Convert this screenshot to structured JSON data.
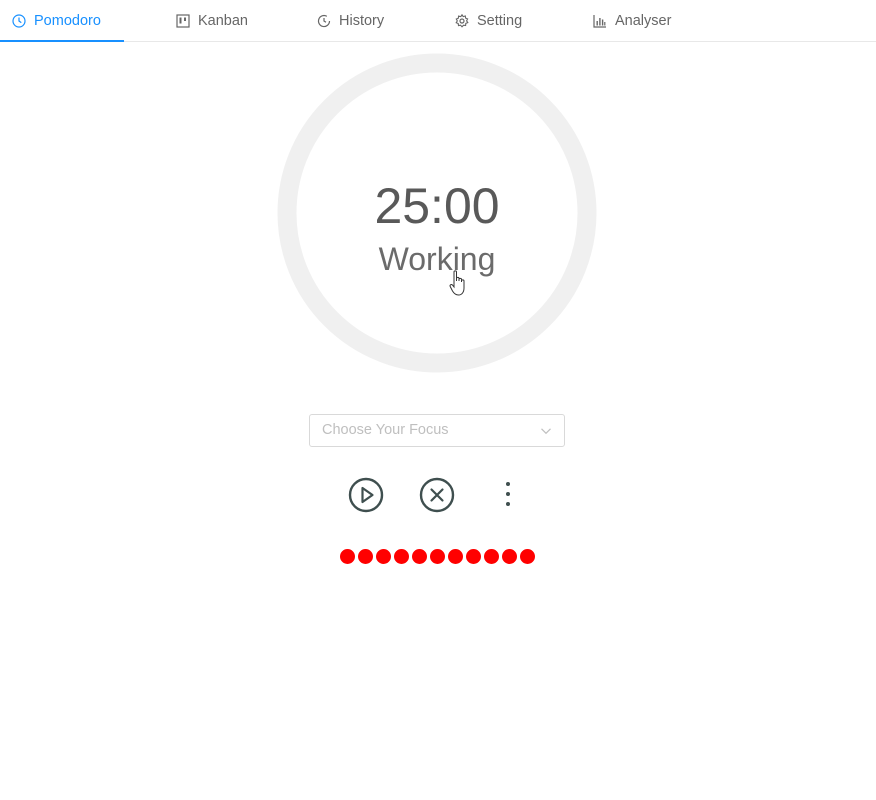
{
  "tabs": [
    {
      "label": "Pomodoro",
      "icon": "clock-icon",
      "active": true
    },
    {
      "label": "Kanban",
      "icon": "kanban-icon",
      "active": false
    },
    {
      "label": "History",
      "icon": "history-icon",
      "active": false
    },
    {
      "label": "Setting",
      "icon": "gear-icon",
      "active": false
    },
    {
      "label": "Analyser",
      "icon": "bar-chart-icon",
      "active": false
    }
  ],
  "timer": {
    "time": "25:00",
    "status": "Working"
  },
  "focus_select": {
    "placeholder": "Choose Your Focus"
  },
  "controls": {
    "play_icon": "play-circle-icon",
    "stop_icon": "close-circle-icon",
    "more_icon": "more-vertical-icon"
  },
  "session_dots": {
    "count": 11,
    "color": "#ff0000"
  },
  "colors": {
    "accent": "#1890ff",
    "ring": "#f0f0f0",
    "control": "#3f4f4f"
  }
}
